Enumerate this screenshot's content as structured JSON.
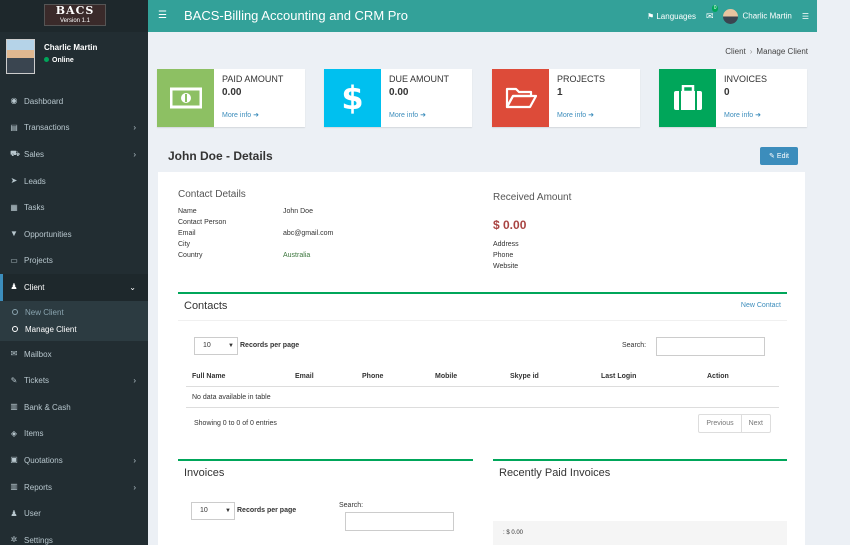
{
  "sidebar": {
    "logo_line1": "BACS",
    "logo_line2": "Version 1.1",
    "user_name": "Charlic Martin",
    "user_status": "Online",
    "items": [
      {
        "label": "Dashboard",
        "icon": "dashboard-icon",
        "glyph": "◉"
      },
      {
        "label": "Transactions",
        "icon": "list-icon",
        "glyph": "▤",
        "chevron": "›"
      },
      {
        "label": "Sales",
        "icon": "cart-icon",
        "glyph": "⛟",
        "chevron": "›"
      },
      {
        "label": "Leads",
        "icon": "rocket-icon",
        "glyph": "➤"
      },
      {
        "label": "Tasks",
        "icon": "tasks-icon",
        "glyph": "▦"
      },
      {
        "label": "Opportunities",
        "icon": "filter-icon",
        "glyph": "▼"
      },
      {
        "label": "Projects",
        "icon": "folder-icon",
        "glyph": "▭"
      },
      {
        "label": "Client",
        "icon": "users-icon",
        "glyph": "♟",
        "chevron": "⌄"
      }
    ],
    "client_sub": [
      {
        "label": "New Client"
      },
      {
        "label": "Manage Client"
      }
    ],
    "items2": [
      {
        "label": "Mailbox",
        "icon": "envelope-icon",
        "glyph": "✉"
      },
      {
        "label": "Tickets",
        "icon": "ticket-icon",
        "glyph": "✎",
        "chevron": "›"
      },
      {
        "label": "Bank & Cash",
        "icon": "bank-icon",
        "glyph": "▥"
      },
      {
        "label": "Items",
        "icon": "cube-icon",
        "glyph": "◈"
      },
      {
        "label": "Quotations",
        "icon": "file-icon",
        "glyph": "▣",
        "chevron": "›"
      },
      {
        "label": "Reports",
        "icon": "bar-chart-icon",
        "glyph": "▥",
        "chevron": "›"
      },
      {
        "label": "User",
        "icon": "user-group-icon",
        "glyph": "♟"
      },
      {
        "label": "Settings",
        "icon": "cogs-icon",
        "glyph": "✲"
      }
    ]
  },
  "header": {
    "title": "BACS-Billing Accounting and CRM Pro",
    "languages": "Languages",
    "mail_badge": "0",
    "user_name": "Charlic Martin"
  },
  "breadcrumb": {
    "item1": "Client",
    "item2": "Manage Client"
  },
  "info_boxes": [
    {
      "label": "PAID AMOUNT",
      "value": "0.00",
      "more": "More info",
      "color": "#8dc063",
      "icon": "money-icon"
    },
    {
      "label": "DUE AMOUNT",
      "value": "0.00",
      "more": "More info",
      "color": "#00c0ef",
      "icon": "dollar-icon"
    },
    {
      "label": "PROJECTS",
      "value": "1",
      "more": "More info",
      "color": "#dd4b39",
      "icon": "folder-open-icon"
    },
    {
      "label": "INVOICES",
      "value": "0",
      "more": "More info",
      "color": "#00a65a",
      "icon": "briefcase-icon"
    }
  ],
  "page_title": "John Doe - Details",
  "edit_label": "Edit",
  "contact_details": {
    "title": "Contact Details",
    "rows": [
      {
        "label": "Name",
        "value": "John Doe"
      },
      {
        "label": "Contact Person",
        "value": ""
      },
      {
        "label": "Email",
        "value": "abc@gmail.com"
      },
      {
        "label": "City",
        "value": ""
      },
      {
        "label": "Country",
        "value": "Australia"
      }
    ]
  },
  "received": {
    "title": "Received Amount",
    "amount": "$ 0.00",
    "rows": [
      "Address",
      "Phone",
      "Website"
    ]
  },
  "contacts": {
    "title": "Contacts",
    "new_label": "New Contact",
    "records_value": "10",
    "records_label": "Records per page",
    "search_label": "Search:",
    "columns": [
      "Full Name",
      "Email",
      "Phone",
      "Mobile",
      "Skype id",
      "Last Login",
      "Action"
    ],
    "empty": "No data available in table",
    "showing": "Showing 0 to 0 of 0 entries",
    "prev": "Previous",
    "next": "Next"
  },
  "invoices": {
    "title": "Invoices",
    "records_value": "10",
    "records_label": "Records per page",
    "search_label": "Search:"
  },
  "recent": {
    "title": "Recently Paid Invoices",
    "row": ": $ 0.00"
  }
}
